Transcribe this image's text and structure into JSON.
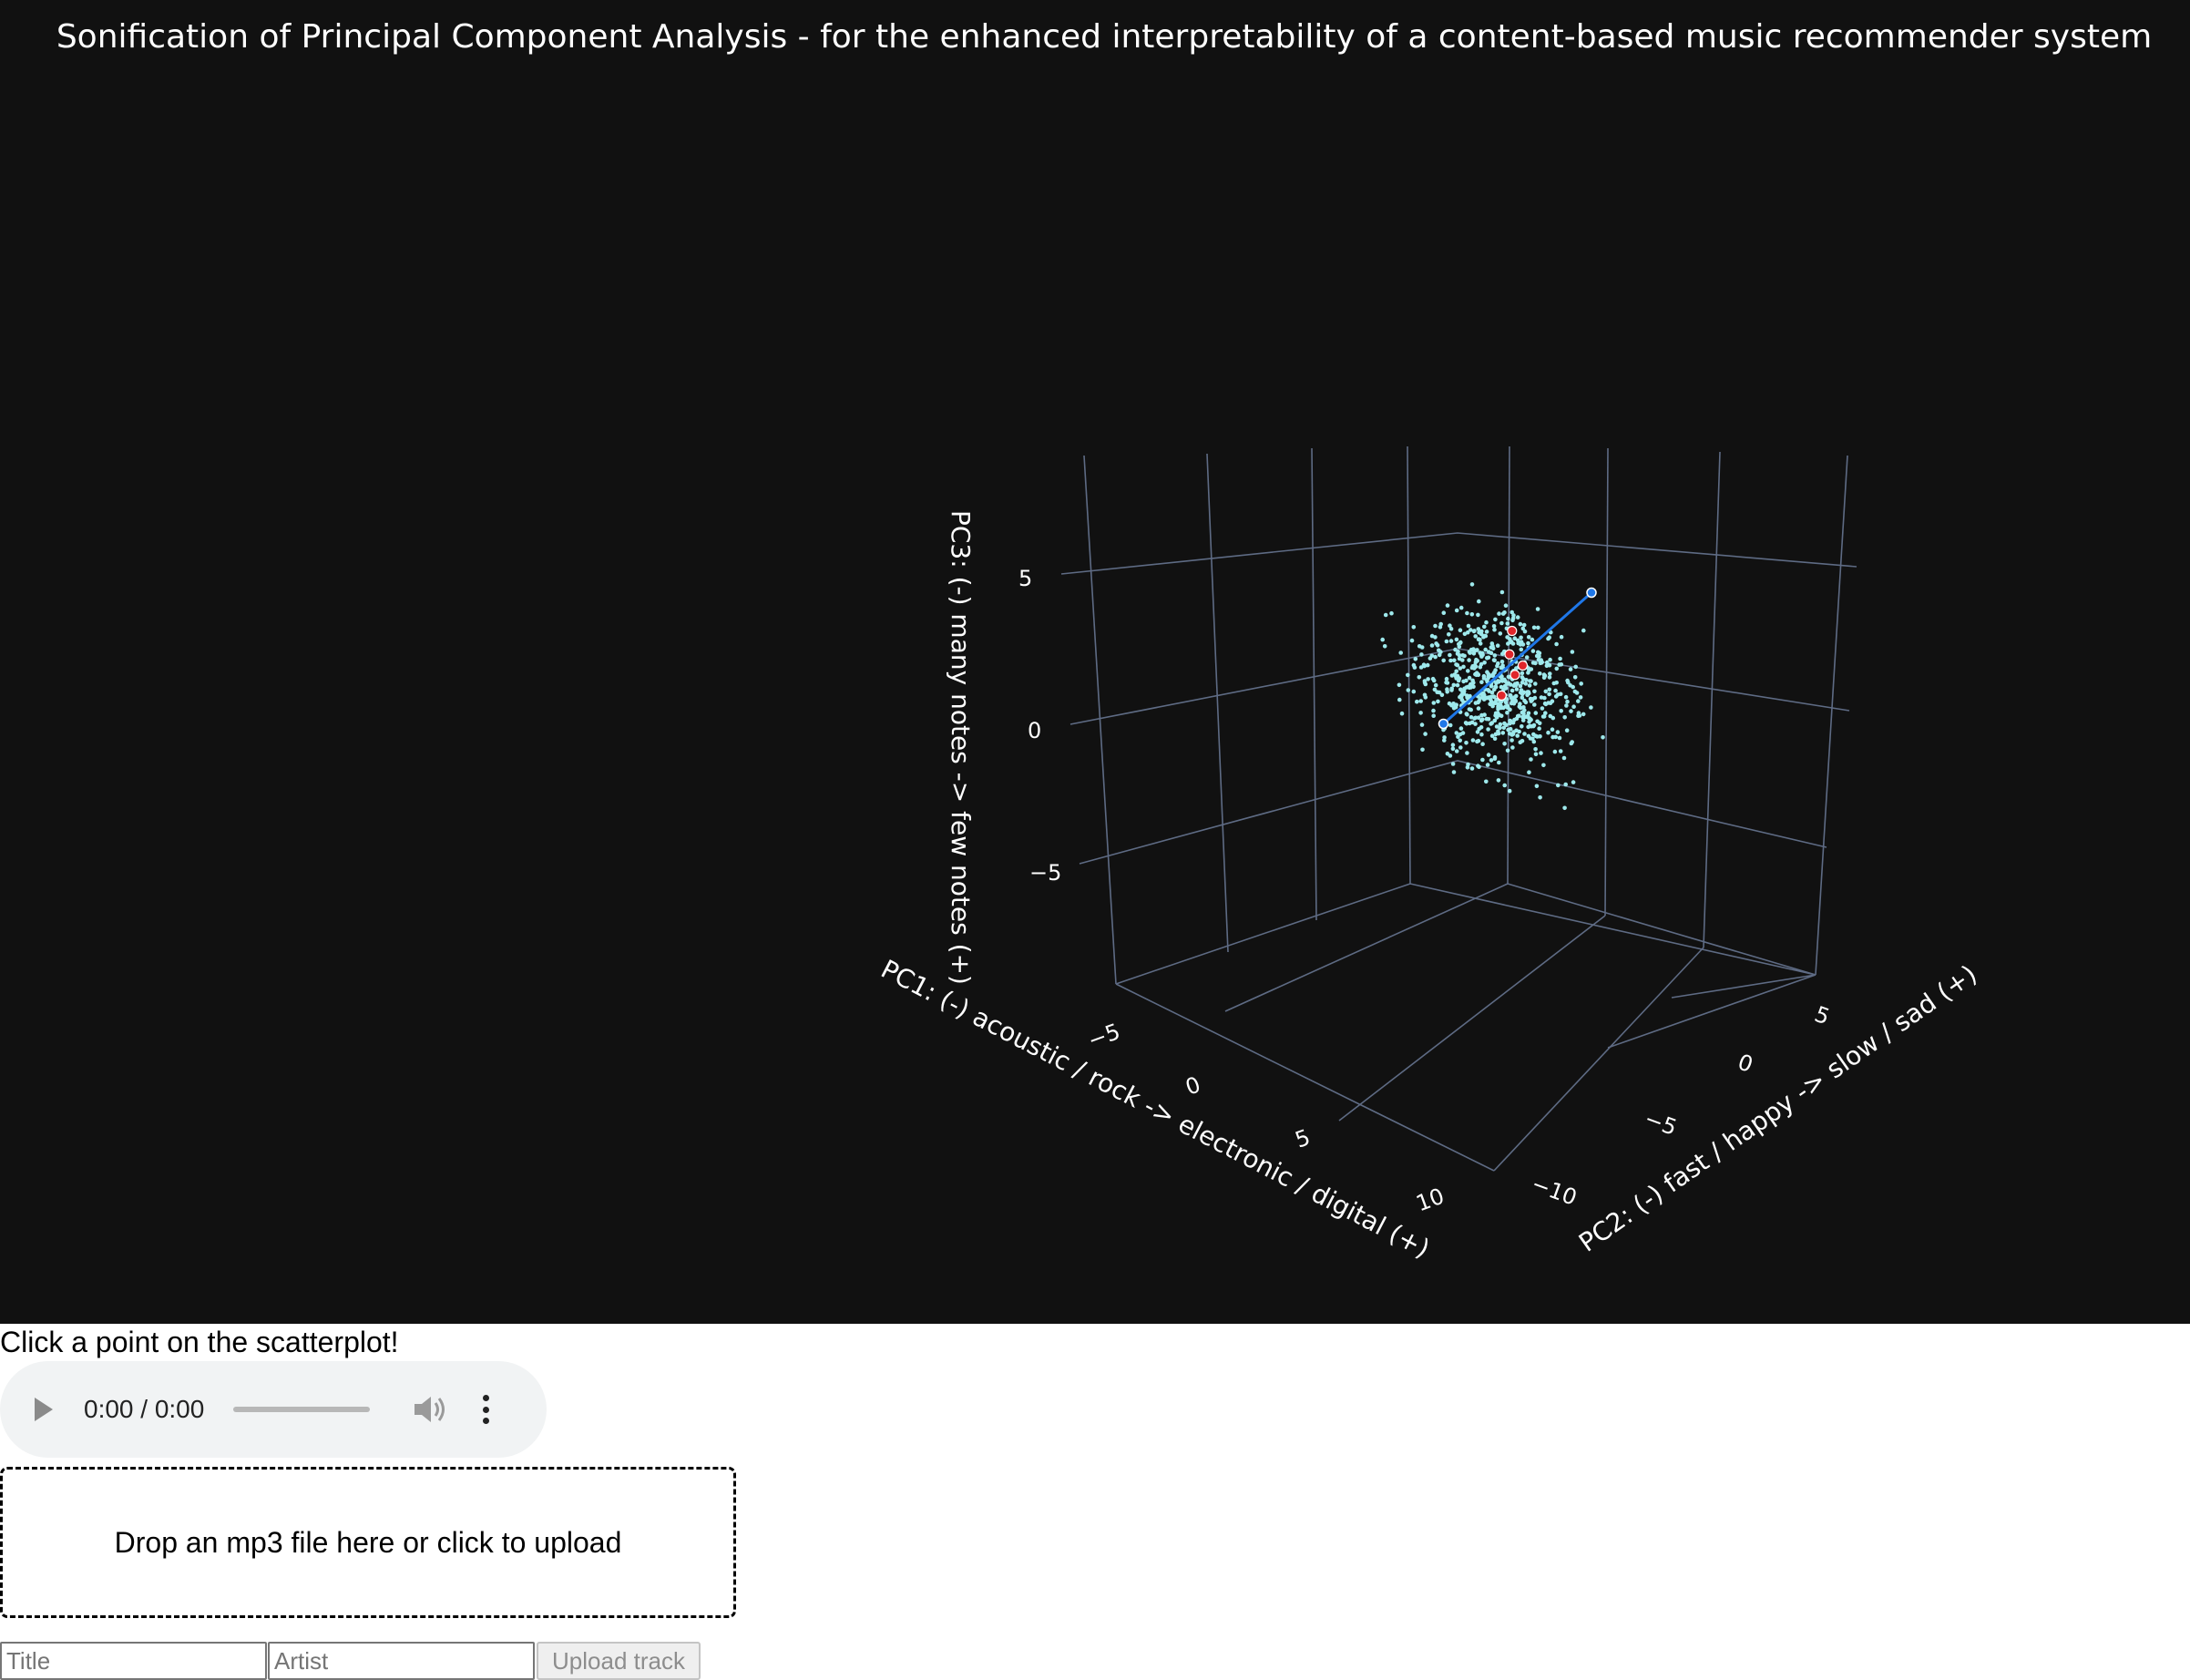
{
  "plot": {
    "title": "Sonification of Principal Component Analysis - for the enhanced interpretability of a content-based music recommender system",
    "background": "#111111",
    "point_color": "#9ee9ec",
    "highlight_color": "#e0262b",
    "line_color": "#1f77e8"
  },
  "chart_data": {
    "type": "scatter",
    "dimensions": 3,
    "x_axis": {
      "label": "PC1: (-) acoustic / rock -> electronic / digital (+)",
      "ticks": [
        "−5",
        "0",
        "5",
        "10"
      ],
      "range": [
        -8,
        12
      ]
    },
    "y_axis": {
      "label": "PC2: (-) fast / happy -> slow / sad (+)",
      "ticks": [
        "−10",
        "−5",
        "0",
        "5"
      ],
      "range": [
        -12,
        8
      ]
    },
    "z_axis": {
      "label": "PC3: (-) many notes -> few notes (+)",
      "ticks": [
        "−5",
        "0",
        "5"
      ],
      "range": [
        -8,
        8
      ]
    },
    "grid": true,
    "series": [
      {
        "approx_count": 700
      },
      {
        "points": [
          [
            1.0,
            1.5,
            2.5
          ],
          [
            1.5,
            0.5,
            2.0
          ],
          [
            2.0,
            1.0,
            1.5
          ],
          [
            2.5,
            -0.5,
            1.8
          ],
          [
            1.2,
            0.2,
            0.2
          ]
        ]
      }
    ],
    "highlight_line": [
      [
        -1.0,
        -2.0,
        -1.0
      ],
      [
        5.0,
        3.0,
        5.0
      ]
    ]
  },
  "player": {
    "instruction": "Click a point on the scatterplot!",
    "time": "0:00 / 0:00"
  },
  "upload": {
    "dropzone_text": "Drop an mp3 file here or click to upload",
    "title_placeholder": "Title",
    "artist_placeholder": "Artist",
    "button_label": "Upload track"
  }
}
